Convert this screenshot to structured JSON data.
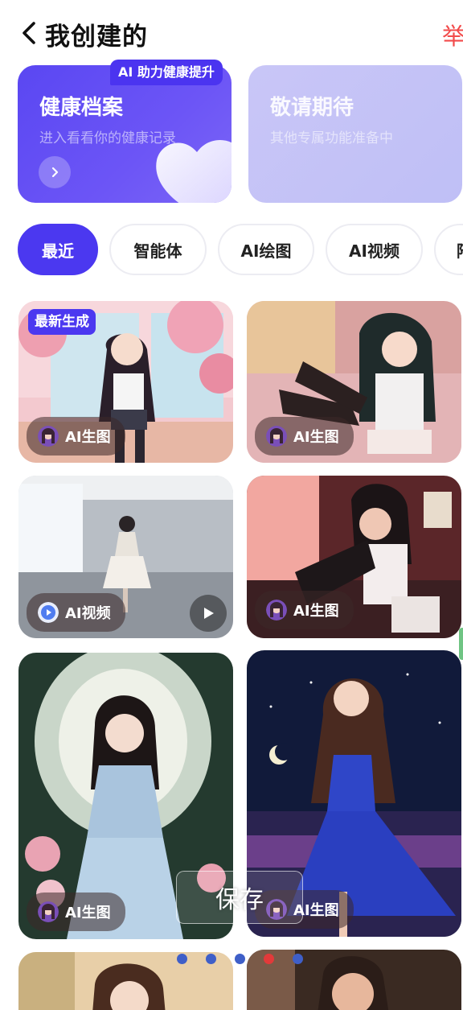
{
  "header": {
    "title": "我创建的",
    "report_label": "举"
  },
  "cards": {
    "health": {
      "title": "健康档案",
      "subtitle": "进入看看你的健康记录",
      "badge": "AI 助力健康提升"
    },
    "soon": {
      "title": "敬请期待",
      "subtitle": "其他专属功能准备中"
    }
  },
  "tabs": [
    {
      "label": "最近",
      "active": true
    },
    {
      "label": "智能体",
      "active": false
    },
    {
      "label": "AI绘图",
      "active": false
    },
    {
      "label": "AI视频",
      "active": false
    },
    {
      "label": "陪",
      "active": false
    }
  ],
  "grid": {
    "new_tag": "最新生成",
    "items": [
      {
        "type_label": "AI生图",
        "kind": "image"
      },
      {
        "type_label": "AI生图",
        "kind": "image"
      },
      {
        "type_label": "AI视频",
        "kind": "video"
      },
      {
        "type_label": "AI生图",
        "kind": "image"
      },
      {
        "type_label": "AI生图",
        "kind": "image"
      },
      {
        "type_label": "AI生图",
        "kind": "image"
      }
    ]
  },
  "overlay": {
    "save_label": "保存"
  },
  "colors": {
    "accent": "#4b38f0",
    "report": "#f24b4b",
    "card_health": "#5a47f2",
    "card_soon": "#c9c6f7"
  }
}
